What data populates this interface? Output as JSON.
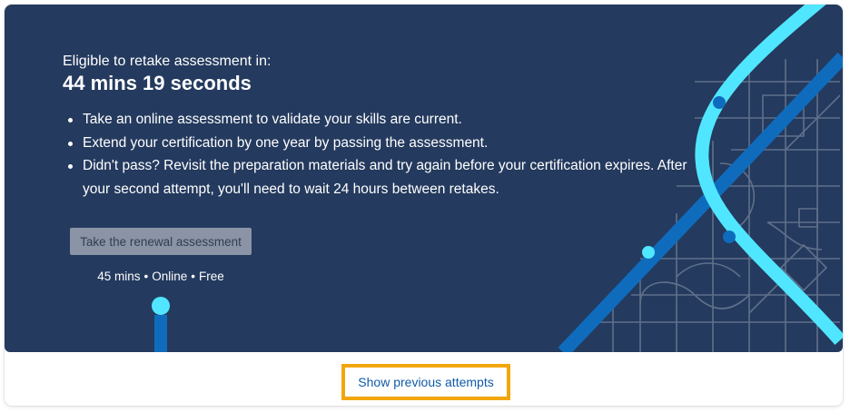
{
  "hero": {
    "eyebrow": "Eligible to retake assessment in:",
    "countdown": "44 mins 19 seconds",
    "bullets": [
      "Take an online assessment to validate your skills are current.",
      "Extend your certification by one year by passing the assessment.",
      "Didn't pass? Revisit the preparation materials and try again before your certification expires. After your second attempt, you'll need to wait 24 hours between retakes."
    ],
    "renew_button_label": "Take the renewal assessment",
    "meta": {
      "duration": "45 mins",
      "mode": "Online",
      "price": "Free",
      "separator": "•"
    }
  },
  "footer": {
    "show_previous_label": "Show previous attempts"
  },
  "colors": {
    "hero_background": "#243a5e",
    "accent_cyan": "#50e6ff",
    "accent_blue": "#0f6cbd",
    "focus_outline": "#f2a60c",
    "link": "#0f5aa8"
  },
  "icons": {
    "timeline_marker": "timeline-dot-icon"
  }
}
